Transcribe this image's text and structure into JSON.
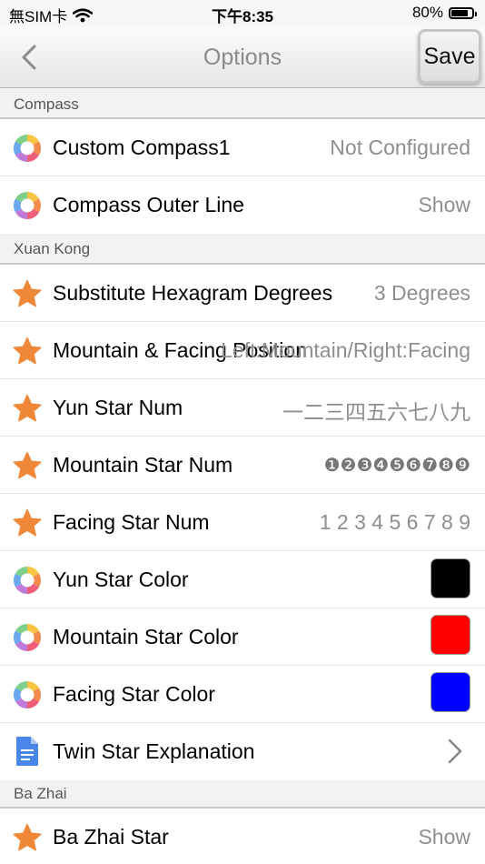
{
  "status_bar": {
    "carrier": "無SIM卡",
    "time": "下午8:35",
    "battery_text": "80%",
    "battery_level": 0.8
  },
  "nav": {
    "title": "Options",
    "save_label": "Save"
  },
  "sections": {
    "compass": "Compass",
    "xuan_kong": "Xuan Kong",
    "ba_zhai": "Ba Zhai"
  },
  "rows": {
    "custom_compass": {
      "label": "Custom Compass1",
      "value": "Not Configured",
      "icon": "color-wheel-icon"
    },
    "compass_outer_line": {
      "label": "Compass Outer Line",
      "value": "Show",
      "icon": "color-wheel-icon"
    },
    "substitute_hexagram": {
      "label": "Substitute Hexagram Degrees",
      "value": "3 Degrees",
      "icon": "star-icon"
    },
    "mountain_facing_position": {
      "label": "Mountain & Facing Position",
      "value": "Left:Mountain/Right:Facing",
      "icon": "star-icon"
    },
    "yun_star_num": {
      "label": "Yun Star Num",
      "value": "一二三四五六七八九",
      "icon": "star-icon"
    },
    "mountain_star_num": {
      "label": "Mountain Star Num",
      "value": "❶❷❸❹❺❻❼❽❾",
      "icon": "star-icon"
    },
    "facing_star_num": {
      "label": "Facing Star Num",
      "value": "1 2 3 4 5 6 7 8 9",
      "icon": "star-icon"
    },
    "yun_star_color": {
      "label": "Yun Star Color",
      "color": "#000000",
      "icon": "color-wheel-icon"
    },
    "mountain_star_color": {
      "label": "Mountain Star Color",
      "color": "#ff0000",
      "icon": "color-wheel-icon"
    },
    "facing_star_color": {
      "label": "Facing Star Color",
      "color": "#0000ff",
      "icon": "color-wheel-icon"
    },
    "twin_star_explanation": {
      "label": "Twin Star Explanation",
      "icon": "document-icon"
    },
    "ba_zhai_star": {
      "label": "Ba Zhai Star",
      "value": "Show",
      "icon": "star-icon"
    }
  },
  "colors": {
    "star_icon": "#f0883a",
    "document_icon": "#4a86e8",
    "value_text": "#8e8e8e"
  }
}
